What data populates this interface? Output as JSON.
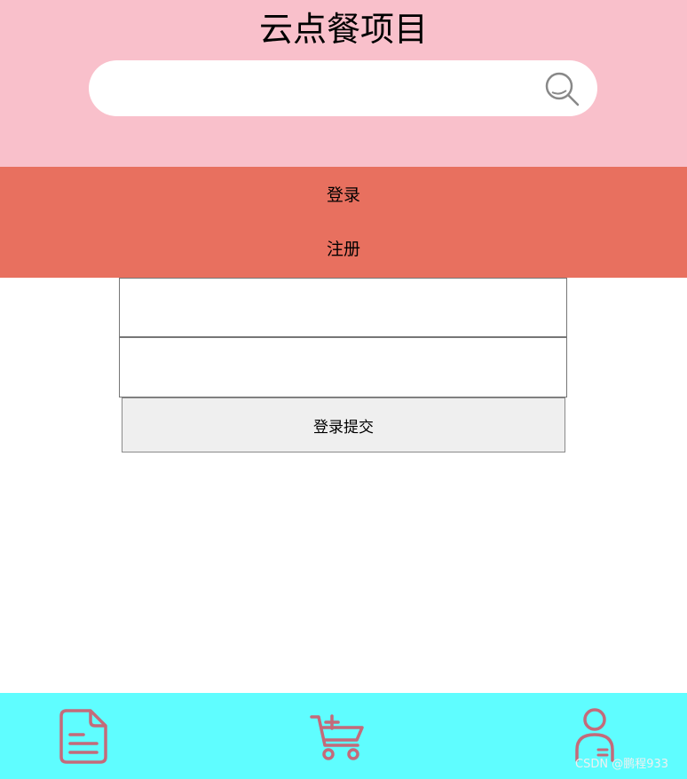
{
  "header": {
    "title": "云点餐项目",
    "search": {
      "value": "",
      "placeholder": "",
      "icon": "search-icon"
    }
  },
  "nav": {
    "items": [
      {
        "label": "登录"
      },
      {
        "label": "注册"
      }
    ]
  },
  "form": {
    "field1": {
      "value": "",
      "placeholder": ""
    },
    "field2": {
      "value": "",
      "placeholder": ""
    },
    "submit_label": "登录提交"
  },
  "footer": {
    "icons": [
      "document-icon",
      "cart-icon",
      "user-icon"
    ],
    "watermark": "CSDN @鹏程933"
  },
  "colors": {
    "header_bg": "#f9c0cb",
    "nav_bg": "#e8705f",
    "footer_bg": "#5ffdff",
    "icon_stroke": "#c46a7a",
    "search_icon": "#888888"
  }
}
